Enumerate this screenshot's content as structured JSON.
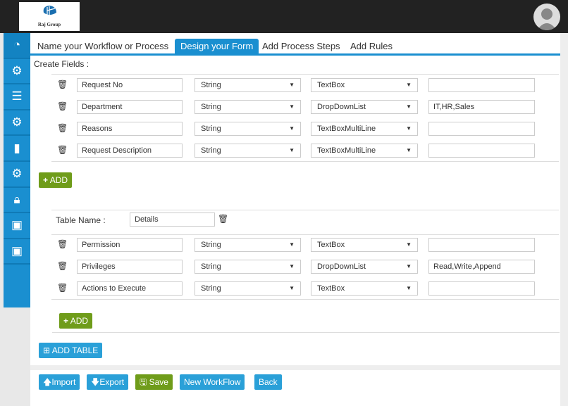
{
  "header": {
    "logo_text": "Raj Group"
  },
  "sidebar": {
    "items": [
      {
        "icon": "dashboard-icon"
      },
      {
        "icon": "gears-icon"
      },
      {
        "icon": "sliders-icon"
      },
      {
        "icon": "gear-chart-icon"
      },
      {
        "icon": "chart-icon"
      },
      {
        "icon": "gear-add-icon"
      },
      {
        "icon": "lock-icon"
      },
      {
        "icon": "monitor-mail-icon"
      },
      {
        "icon": "monitor-mail-icon"
      }
    ]
  },
  "tabs": [
    {
      "label": "Name your Workflow or Process"
    },
    {
      "label": "Design your Form",
      "active": true
    },
    {
      "label": "Add Process Steps"
    },
    {
      "label": "Add Rules"
    }
  ],
  "create_fields_label": "Create Fields :",
  "fields": [
    {
      "name": "Request No",
      "type": "String",
      "control": "TextBox",
      "values": ""
    },
    {
      "name": "Department",
      "type": "String",
      "control": "DropDownList",
      "values": "IT,HR,Sales"
    },
    {
      "name": "Reasons",
      "type": "String",
      "control": "TextBoxMultiLine",
      "values": ""
    },
    {
      "name": "Request Description",
      "type": "String",
      "control": "TextBoxMultiLine",
      "values": ""
    }
  ],
  "add_label": "ADD",
  "table": {
    "name_label": "Table Name :",
    "name_value": "Details",
    "fields": [
      {
        "name": "Permission",
        "type": "String",
        "control": "TextBox",
        "values": ""
      },
      {
        "name": "Privileges",
        "type": "String",
        "control": "DropDownList",
        "values": "Read,Write,Append"
      },
      {
        "name": "Actions to Execute",
        "type": "String",
        "control": "TextBox",
        "values": ""
      }
    ]
  },
  "add_table_label": "ADD TABLE",
  "footer": {
    "import": "Import",
    "export": "Export",
    "save": "Save",
    "new_workflow": "New WorkFlow",
    "back": "Back"
  },
  "colors": {
    "header": "#222222",
    "accent": "#1a8fd0",
    "green": "#6f9c1a",
    "button_blue": "#2aa0d8"
  }
}
